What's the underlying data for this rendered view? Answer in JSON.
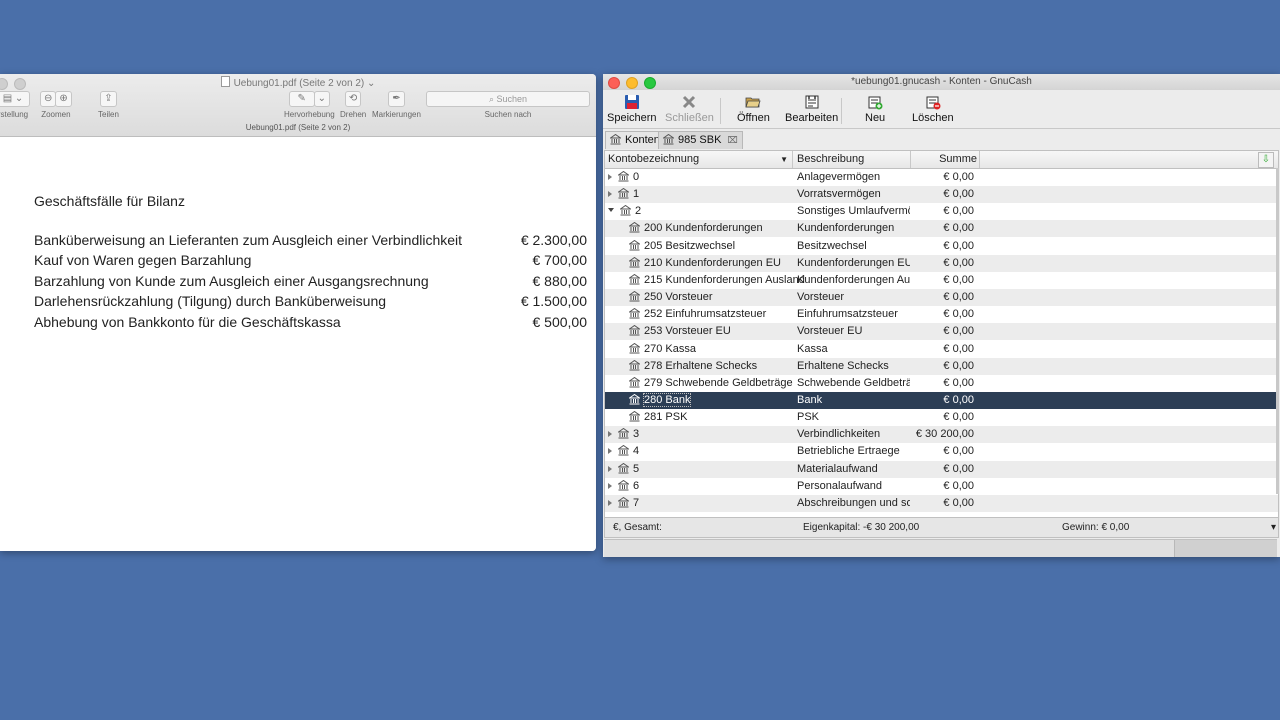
{
  "preview": {
    "title": "Uebung01.pdf (Seite 2 von 2)",
    "title_arrow": "⌄",
    "subtitle": "Uebung01.pdf (Seite 2 von 2)",
    "toolbar": {
      "view_label": "rstellung",
      "zoom_label": "Zoomen",
      "share_label": "Teilen",
      "highlight_label": "Hervorhebung",
      "rotate_label": "Drehen",
      "markup_label": "Markierungen",
      "search_placeholder": "Suchen",
      "search_label": "Suchen nach"
    },
    "document": {
      "heading": "Geschäftsfälle für Bilanz",
      "rows": [
        {
          "text": "Banküberweisung an Lieferanten zum Ausgleich einer Verbindlichkeit",
          "amount": "€ 2.300,00"
        },
        {
          "text": "Kauf von Waren gegen Barzahlung",
          "amount": "€ 700,00"
        },
        {
          "text": "Barzahlung von Kunde zum Ausgleich einer Ausgangsrechnung",
          "amount": "€ 880,00"
        },
        {
          "text": "Darlehensrückzahlung (Tilgung) durch Banküberweisung",
          "amount": "€ 1.500,00"
        },
        {
          "text": "Abhebung von Bankkonto für die Geschäftskassa",
          "amount": "€ 500,00"
        }
      ]
    }
  },
  "gnucash": {
    "title": "*uebung01.gnucash - Konten - GnuCash",
    "toolbar": {
      "save": "Speichern",
      "close": "Schließen",
      "open": "Öffnen",
      "edit": "Bearbeiten",
      "new": "Neu",
      "delete": "Löschen"
    },
    "tabs": [
      {
        "label": "Konten"
      },
      {
        "label": "985 SBK",
        "close": "⌧"
      }
    ],
    "columns": {
      "name": "Kontobezeichnung",
      "desc": "Beschreibung",
      "sum": "Summe"
    },
    "accounts": [
      {
        "name": "0",
        "desc": "Anlagevermögen",
        "sum": "€ 0,00",
        "level": 0,
        "expander": "closed"
      },
      {
        "name": "1",
        "desc": "Vorratsvermögen",
        "sum": "€ 0,00",
        "level": 0,
        "expander": "closed"
      },
      {
        "name": "2",
        "desc": "Sonstiges Umlaufvermög",
        "sum": "€ 0,00",
        "level": 0,
        "expander": "open"
      },
      {
        "name": "200 Kundenforderungen",
        "desc": "Kundenforderungen",
        "sum": "€ 0,00",
        "level": 1
      },
      {
        "name": "205 Besitzwechsel",
        "desc": "Besitzwechsel",
        "sum": "€ 0,00",
        "level": 1
      },
      {
        "name": "210 Kundenforderungen EU",
        "desc": "Kundenforderungen EU",
        "sum": "€ 0,00",
        "level": 1
      },
      {
        "name": "215 Kundenforderungen Ausland",
        "desc": "Kundenforderungen Ausl",
        "sum": "€ 0,00",
        "level": 1
      },
      {
        "name": "250 Vorsteuer",
        "desc": "Vorsteuer",
        "sum": "€ 0,00",
        "level": 1
      },
      {
        "name": "252 Einfuhrumsatzsteuer",
        "desc": "Einfuhrumsatzsteuer",
        "sum": "€ 0,00",
        "level": 1
      },
      {
        "name": "253 Vorsteuer EU",
        "desc": "Vorsteuer EU",
        "sum": "€ 0,00",
        "level": 1
      },
      {
        "name": "270 Kassa",
        "desc": "Kassa",
        "sum": "€ 0,00",
        "level": 1
      },
      {
        "name": "278 Erhaltene Schecks",
        "desc": "Erhaltene Schecks",
        "sum": "€ 0,00",
        "level": 1
      },
      {
        "name": "279 Schwebende Geldbeträge",
        "desc": "Schwebende Geldbeträg",
        "sum": "€ 0,00",
        "level": 1
      },
      {
        "name": "280 Bank",
        "desc": "Bank",
        "sum": "€ 0,00",
        "level": 1,
        "selected": true
      },
      {
        "name": "281 PSK",
        "desc": "PSK",
        "sum": "€ 0,00",
        "level": 1
      },
      {
        "name": "3",
        "desc": "Verbindlichkeiten",
        "sum": "€ 30 200,00",
        "level": 0,
        "expander": "closed"
      },
      {
        "name": "4",
        "desc": "Betriebliche Ertraege",
        "sum": "€ 0,00",
        "level": 0,
        "expander": "closed"
      },
      {
        "name": "5",
        "desc": "Materialaufwand",
        "sum": "€ 0,00",
        "level": 0,
        "expander": "closed"
      },
      {
        "name": "6",
        "desc": "Personalaufwand",
        "sum": "€ 0,00",
        "level": 0,
        "expander": "closed"
      },
      {
        "name": "7",
        "desc": "Abschreibungen und son",
        "sum": "€ 0,00",
        "level": 0,
        "expander": "closed"
      }
    ],
    "status": {
      "total": "€, Gesamt:",
      "equity": "Eigenkapital: -€ 30 200,00",
      "profit": "Gewinn: € 0,00",
      "arrow": "▾"
    }
  },
  "colors": {
    "desktop": "#4a6fa9",
    "selection": "#2c3e55"
  }
}
